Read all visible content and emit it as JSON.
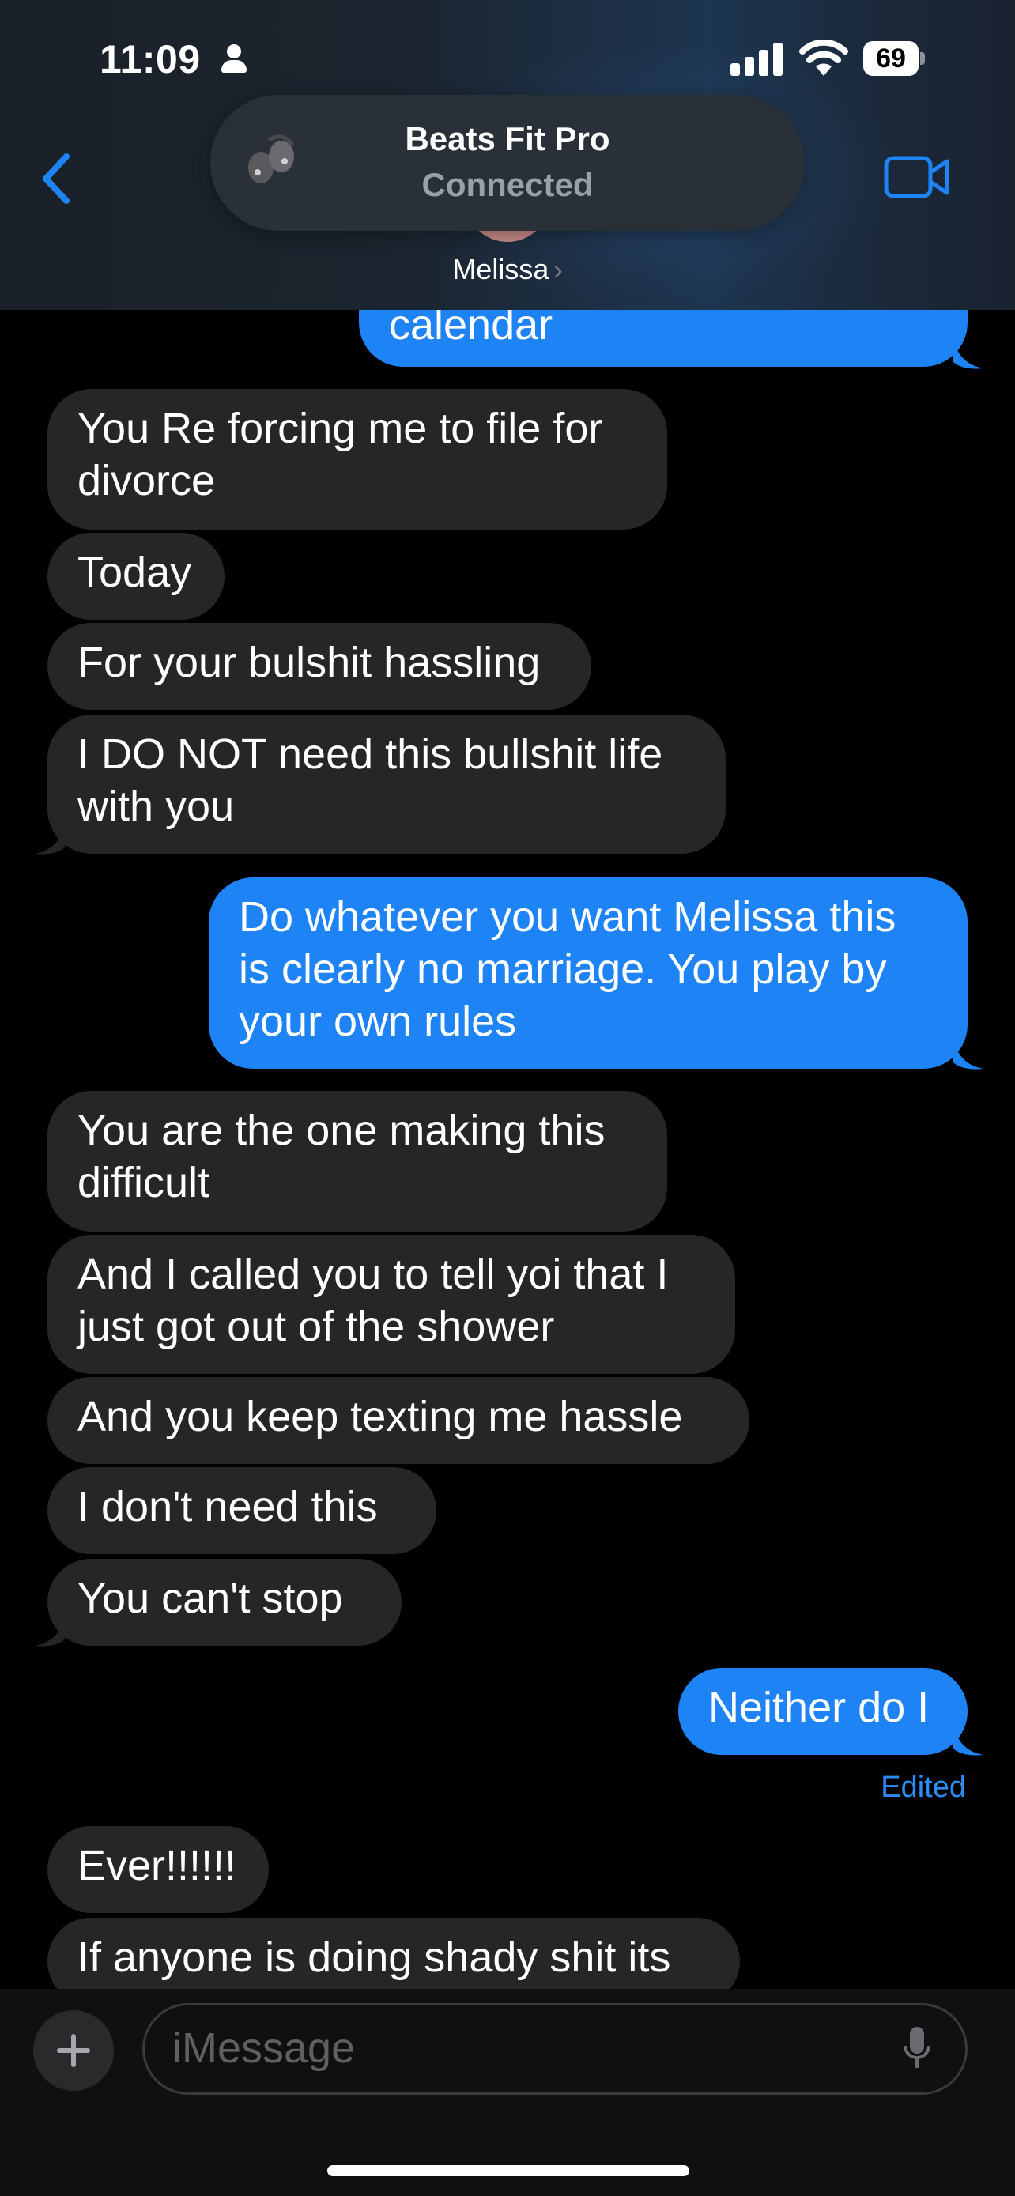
{
  "status_bar": {
    "time": "11:09",
    "battery": "69"
  },
  "header": {
    "device_title": "Beats Fit Pro",
    "device_status": "Connected",
    "contact_name": "Melissa",
    "contact_chevron": "›"
  },
  "messages": [
    {
      "side": "out",
      "lines": [
        "calendar"
      ]
    },
    {
      "side": "in",
      "lines": [
        "You Re forcing me to file for",
        "divorce"
      ]
    },
    {
      "side": "in",
      "lines": [
        "Today"
      ]
    },
    {
      "side": "in",
      "lines": [
        "For your bulshit hassling"
      ]
    },
    {
      "side": "in",
      "lines": [
        "I DO NOT need this bullshit life",
        "with you"
      ]
    },
    {
      "side": "out",
      "lines": [
        "Do whatever you want Melissa this",
        "is clearly no marriage.  You play by",
        "your own rules"
      ]
    },
    {
      "side": "in",
      "lines": [
        "You are the one making this",
        "difficult"
      ]
    },
    {
      "side": "in",
      "lines": [
        "And I called you to tell yoi that I",
        "just got out of the shower"
      ]
    },
    {
      "side": "in",
      "lines": [
        "And you keep texting me hassle"
      ]
    },
    {
      "side": "in",
      "lines": [
        "I don't need this"
      ]
    },
    {
      "side": "in",
      "lines": [
        "You can't stop"
      ]
    },
    {
      "side": "out",
      "lines": [
        "Neither do I"
      ]
    },
    {
      "side": "in",
      "lines": [
        "Ever!!!!!!"
      ]
    },
    {
      "side": "in",
      "lines": [
        "If anyone is doing shady shit its"
      ]
    }
  ],
  "edited_label": "Edited",
  "composer": {
    "placeholder": "iMessage"
  },
  "colors": {
    "incoming_bubble": "#262628",
    "outgoing_bubble": "#1e84f5",
    "accent": "#2b8cf4"
  }
}
